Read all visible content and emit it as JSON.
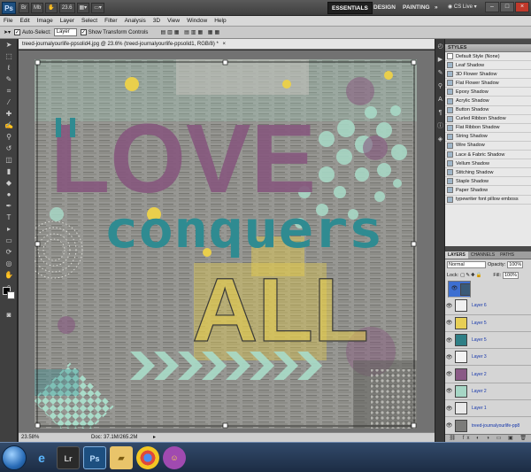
{
  "appbar": {
    "logo": "Ps",
    "zoom_value": "23.6",
    "workspaces": [
      "ESSENTIALS",
      "DESIGN",
      "PAINTING"
    ],
    "more": "»",
    "cs_live": "CS Live"
  },
  "menu": [
    "File",
    "Edit",
    "Image",
    "Layer",
    "Select",
    "Filter",
    "Analysis",
    "3D",
    "View",
    "Window",
    "Help"
  ],
  "options": {
    "auto_select_label": "Auto-Select:",
    "auto_select_value": "Layer",
    "transform_label": "Show Transform Controls"
  },
  "document": {
    "tab_title": "treed-journalyourlife-ppsolid4.jpg @ 23.6% (treed-journalyourlife-ppsolid1, RGB/8) *",
    "zoom_status": "23.58%",
    "doc_status": "Doc: 37.1M/265.2M"
  },
  "artwork": {
    "love": "LOVE",
    "conquers": "conquers",
    "all": "ALL"
  },
  "styles_panel": {
    "title": "STYLES",
    "items": [
      "Default Style (None)",
      "Leaf Shadow",
      "3D Flower Shadow",
      "Flat Flower Shadow",
      "Epoxy Shadow",
      "Acrylic Shadow",
      "Button Shadow",
      "Curled Ribbon Shadow",
      "Flat Ribbon Shadow",
      "String Shadow",
      "Wire Shadow",
      "Lace & Fabric Shadow",
      "Vellum Shadow",
      "Stitching Shadow",
      "Staple Shadow",
      "Paper Shadow",
      "typewriter font pillow emboss"
    ]
  },
  "layers_panel": {
    "tabs": [
      "LAYERS",
      "CHANNELS",
      "PATHS"
    ],
    "blend_mode": "Normal",
    "opacity_label": "Opacity:",
    "opacity_value": "100%",
    "lock_label": "Lock:",
    "fill_label": "Fill:",
    "fill_value": "100%",
    "layers": [
      {
        "name": "treed-journalyourlife",
        "thumb": "#3a5a78"
      },
      {
        "name": "Layer 6",
        "thumb": "#f0f0f0"
      },
      {
        "name": "Layer 5",
        "thumb": "#e7cf55"
      },
      {
        "name": "Layer 5",
        "thumb": "#2f7f86"
      },
      {
        "name": "Layer 3",
        "thumb": "#f2f2f2"
      },
      {
        "name": "Layer 2",
        "thumb": "#8a5a86"
      },
      {
        "name": "Layer 2",
        "thumb": "#a6d6c5"
      },
      {
        "name": "Layer 1",
        "thumb": "#e8e8e8"
      },
      {
        "name": "treed-journalyourlife-pp8",
        "thumb": "#7c7c7a"
      }
    ]
  },
  "colors": {
    "purple": "#86577e",
    "teal": "#2f8b91",
    "yellow": "#e9cf4c",
    "mint": "#a9dcc9",
    "selection": "#3d6fd1"
  }
}
